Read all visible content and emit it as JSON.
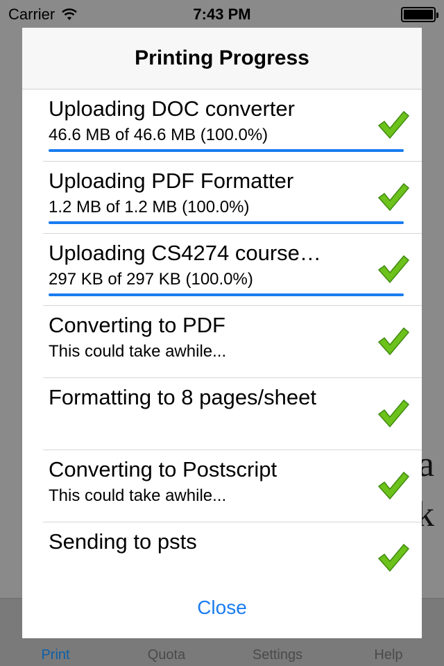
{
  "status_bar": {
    "carrier": "Carrier",
    "time": "7:43 PM",
    "wifi_icon": "wifi-icon",
    "battery_icon": "battery-icon",
    "battery_level": 1.0
  },
  "modal": {
    "title": "Printing Progress",
    "close_label": "Close",
    "tasks": [
      {
        "title": "Uploading DOC converter",
        "subtitle": "46.6 MB of 46.6 MB (100.0%)",
        "progress": 1.0,
        "status_icon": "checkmark-icon"
      },
      {
        "title": "Uploading PDF Formatter",
        "subtitle": "1.2 MB of 1.2 MB (100.0%)",
        "progress": 1.0,
        "status_icon": "checkmark-icon"
      },
      {
        "title": "Uploading CS4274 course…",
        "subtitle": "297 KB of 297 KB (100.0%)",
        "progress": 1.0,
        "status_icon": "checkmark-icon"
      },
      {
        "title": "Converting to PDF",
        "subtitle": "This could take awhile...",
        "status_icon": "checkmark-icon"
      },
      {
        "title": "Formatting to 8 pages/sheet",
        "subtitle": "",
        "status_icon": "checkmark-icon"
      },
      {
        "title": "Converting to Postscript",
        "subtitle": "This could take awhile...",
        "status_icon": "checkmark-icon"
      },
      {
        "title": "Sending to psts",
        "subtitle": "",
        "status_icon": "checkmark-icon"
      }
    ]
  },
  "background": {
    "glyph_1": "a",
    "glyph_2": "k"
  },
  "tab_bar": {
    "tabs": [
      {
        "label": "Print",
        "icon": "print-icon",
        "active": true
      },
      {
        "label": "Quota",
        "icon": "quota-icon",
        "active": false
      },
      {
        "label": "Settings",
        "icon": "settings-icon",
        "active": false
      },
      {
        "label": "Help",
        "icon": "help-icon",
        "active": false
      }
    ]
  },
  "colors": {
    "accent": "#1a7cf0",
    "check_green": "#6cc21b"
  }
}
